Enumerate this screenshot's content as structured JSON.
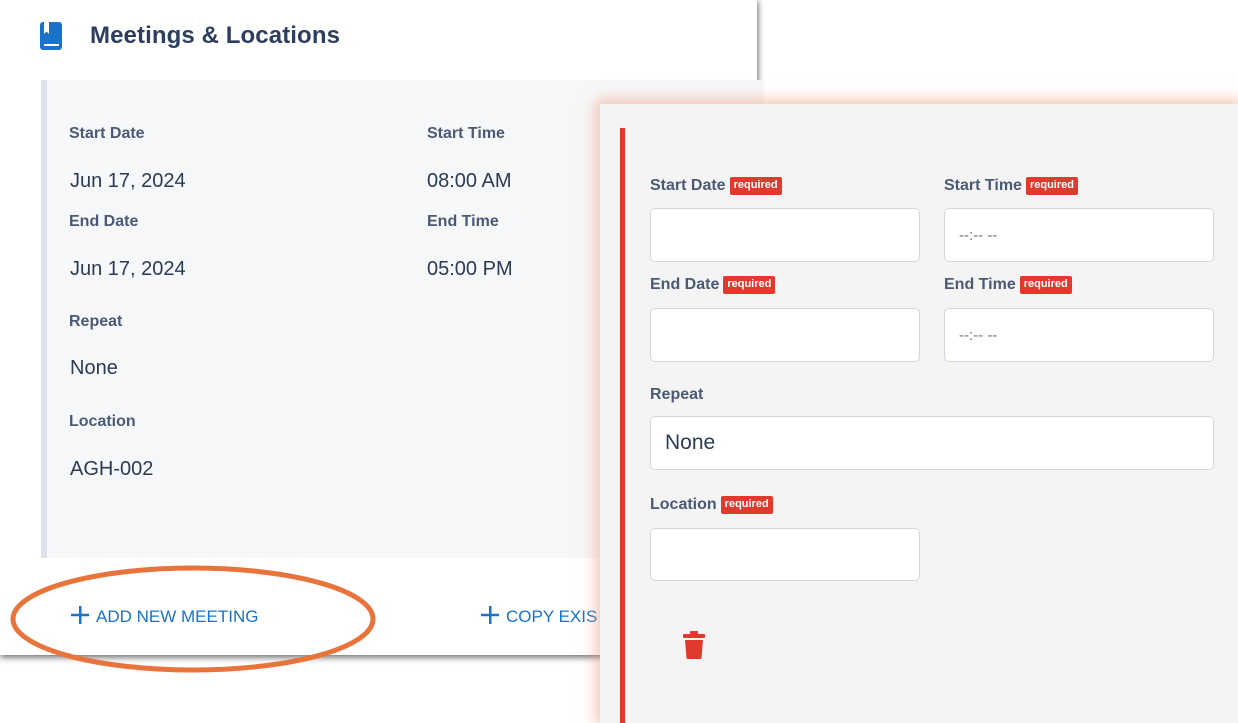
{
  "section": {
    "title": "Meetings & Locations"
  },
  "summary": {
    "start_date": {
      "label": "Start Date",
      "value": "Jun 17, 2024"
    },
    "start_time": {
      "label": "Start Time",
      "value": "08:00 AM"
    },
    "end_date": {
      "label": "End Date",
      "value": "Jun 17, 2024"
    },
    "end_time": {
      "label": "End Time",
      "value": "05:00 PM"
    },
    "repeat": {
      "label": "Repeat",
      "value": "None"
    },
    "location": {
      "label": "Location",
      "value": "AGH-002"
    }
  },
  "actions": {
    "add_new_meeting": "ADD NEW MEETING",
    "copy_existing": "COPY EXIS"
  },
  "form": {
    "required_badge": "required",
    "start_date": {
      "label": "Start Date",
      "value": ""
    },
    "start_time": {
      "label": "Start Time",
      "placeholder": "--:-- --"
    },
    "end_date": {
      "label": "End Date",
      "value": ""
    },
    "end_time": {
      "label": "End Time",
      "placeholder": "--:-- --"
    },
    "repeat": {
      "label": "Repeat",
      "value": "None"
    },
    "location": {
      "label": "Location",
      "value": ""
    }
  },
  "colors": {
    "accent_blue": "#1a73c8",
    "required_red": "#e03a2f",
    "highlight_orange": "#e8743b",
    "heading_navy": "#2d3e5e"
  },
  "icons": [
    "book-icon",
    "plus-icon",
    "trash-icon"
  ]
}
